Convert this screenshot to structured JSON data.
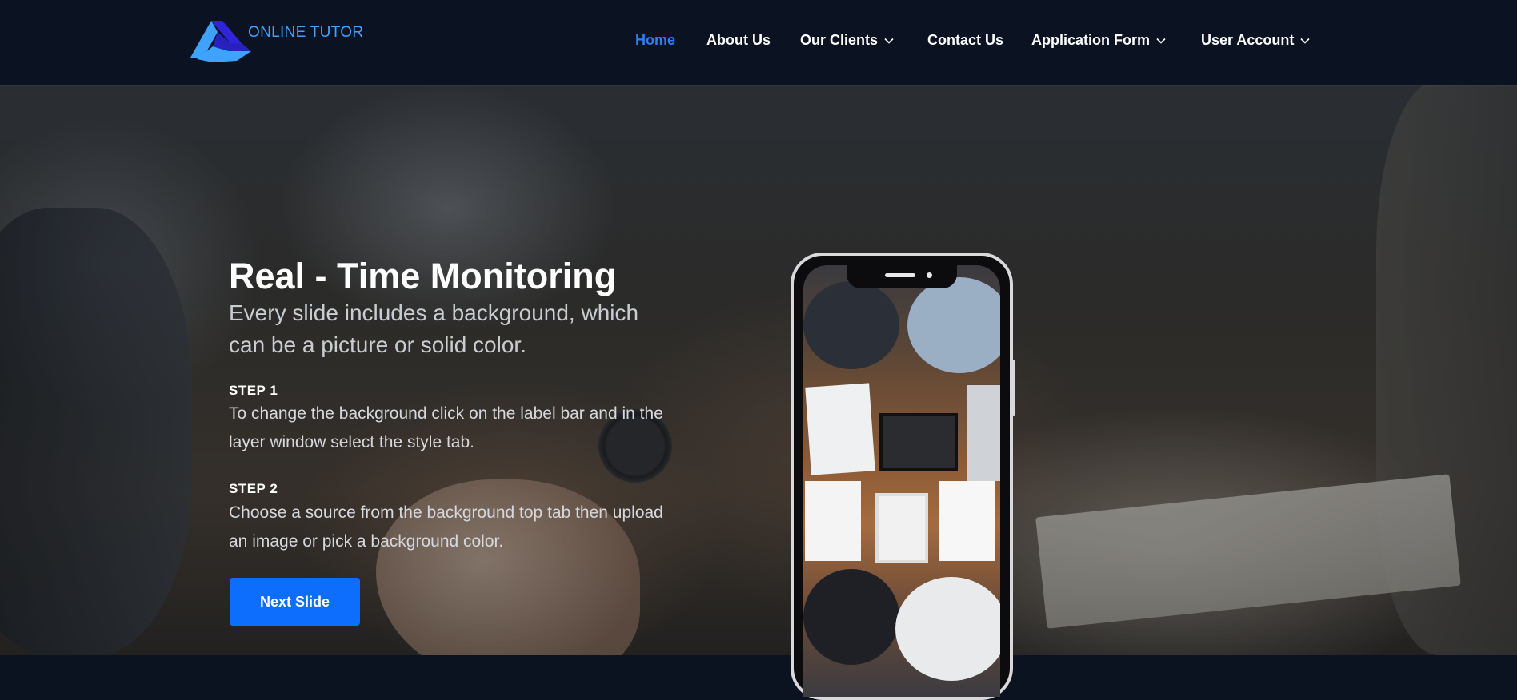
{
  "brand": {
    "name": "ONLINE TUTOR"
  },
  "nav": {
    "items": [
      {
        "label": "Home",
        "active": true,
        "dropdown": false
      },
      {
        "label": "About Us",
        "active": false,
        "dropdown": false
      },
      {
        "label": "Our Clients",
        "active": false,
        "dropdown": true
      },
      {
        "label": "Contact Us",
        "active": false,
        "dropdown": false
      },
      {
        "label": "Application Form",
        "active": false,
        "dropdown": true
      },
      {
        "label": "User Account",
        "active": false,
        "dropdown": true
      }
    ]
  },
  "hero": {
    "title": "Real - Time Monitoring",
    "subtitle": "Every slide includes a background, which can be a picture or solid color.",
    "steps": [
      {
        "label": "STEP 1",
        "text": "To change the background click on the label bar and in the layer window select the style tab."
      },
      {
        "label": "STEP 2",
        "text": "Choose a source from the background top tab then upload an image or pick a background color."
      }
    ],
    "cta_label": "Next Slide"
  },
  "colors": {
    "navbar_bg": "#0b1222",
    "accent": "#2f7ff2",
    "brand_text": "#3ea2ff",
    "button_bg": "#0d6efd"
  },
  "icons": {
    "logo": "online-tutor-logo",
    "dropdown": "chevron-down-icon"
  }
}
